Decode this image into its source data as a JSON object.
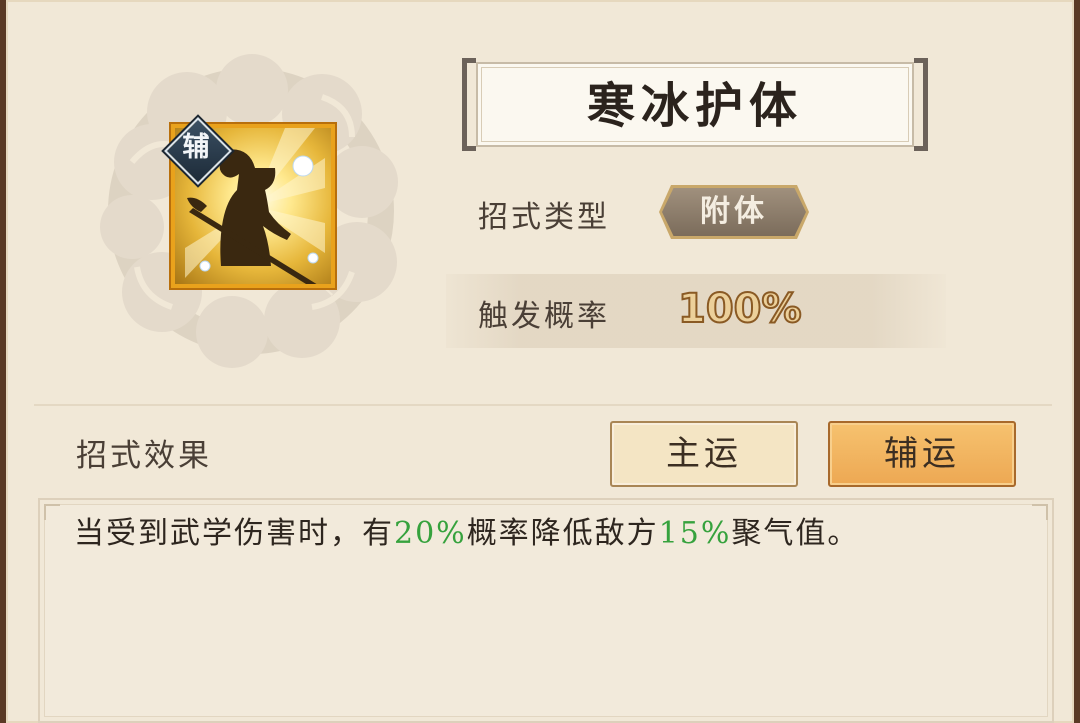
{
  "skill": {
    "name": "寒冰护体",
    "role_badge": "辅",
    "icon": "silhouette-spear-warrior-icon"
  },
  "info": {
    "type_label": "招式类型",
    "type_value": "附体",
    "rate_label": "触发概率",
    "rate_value": "100%"
  },
  "effect": {
    "section_label": "招式效果",
    "tabs": [
      {
        "label": "主运",
        "active": false
      },
      {
        "label": "辅运",
        "active": true
      }
    ],
    "description": {
      "part1": "当受到武学伤害时，有",
      "value1": "20%",
      "part2": "概率降低敌方",
      "value2": "15%",
      "part3": "聚气值。"
    }
  },
  "colors": {
    "highlight": "#36a23d",
    "active_tab": "#eda853",
    "panel_bg": "#f1e8d7"
  }
}
